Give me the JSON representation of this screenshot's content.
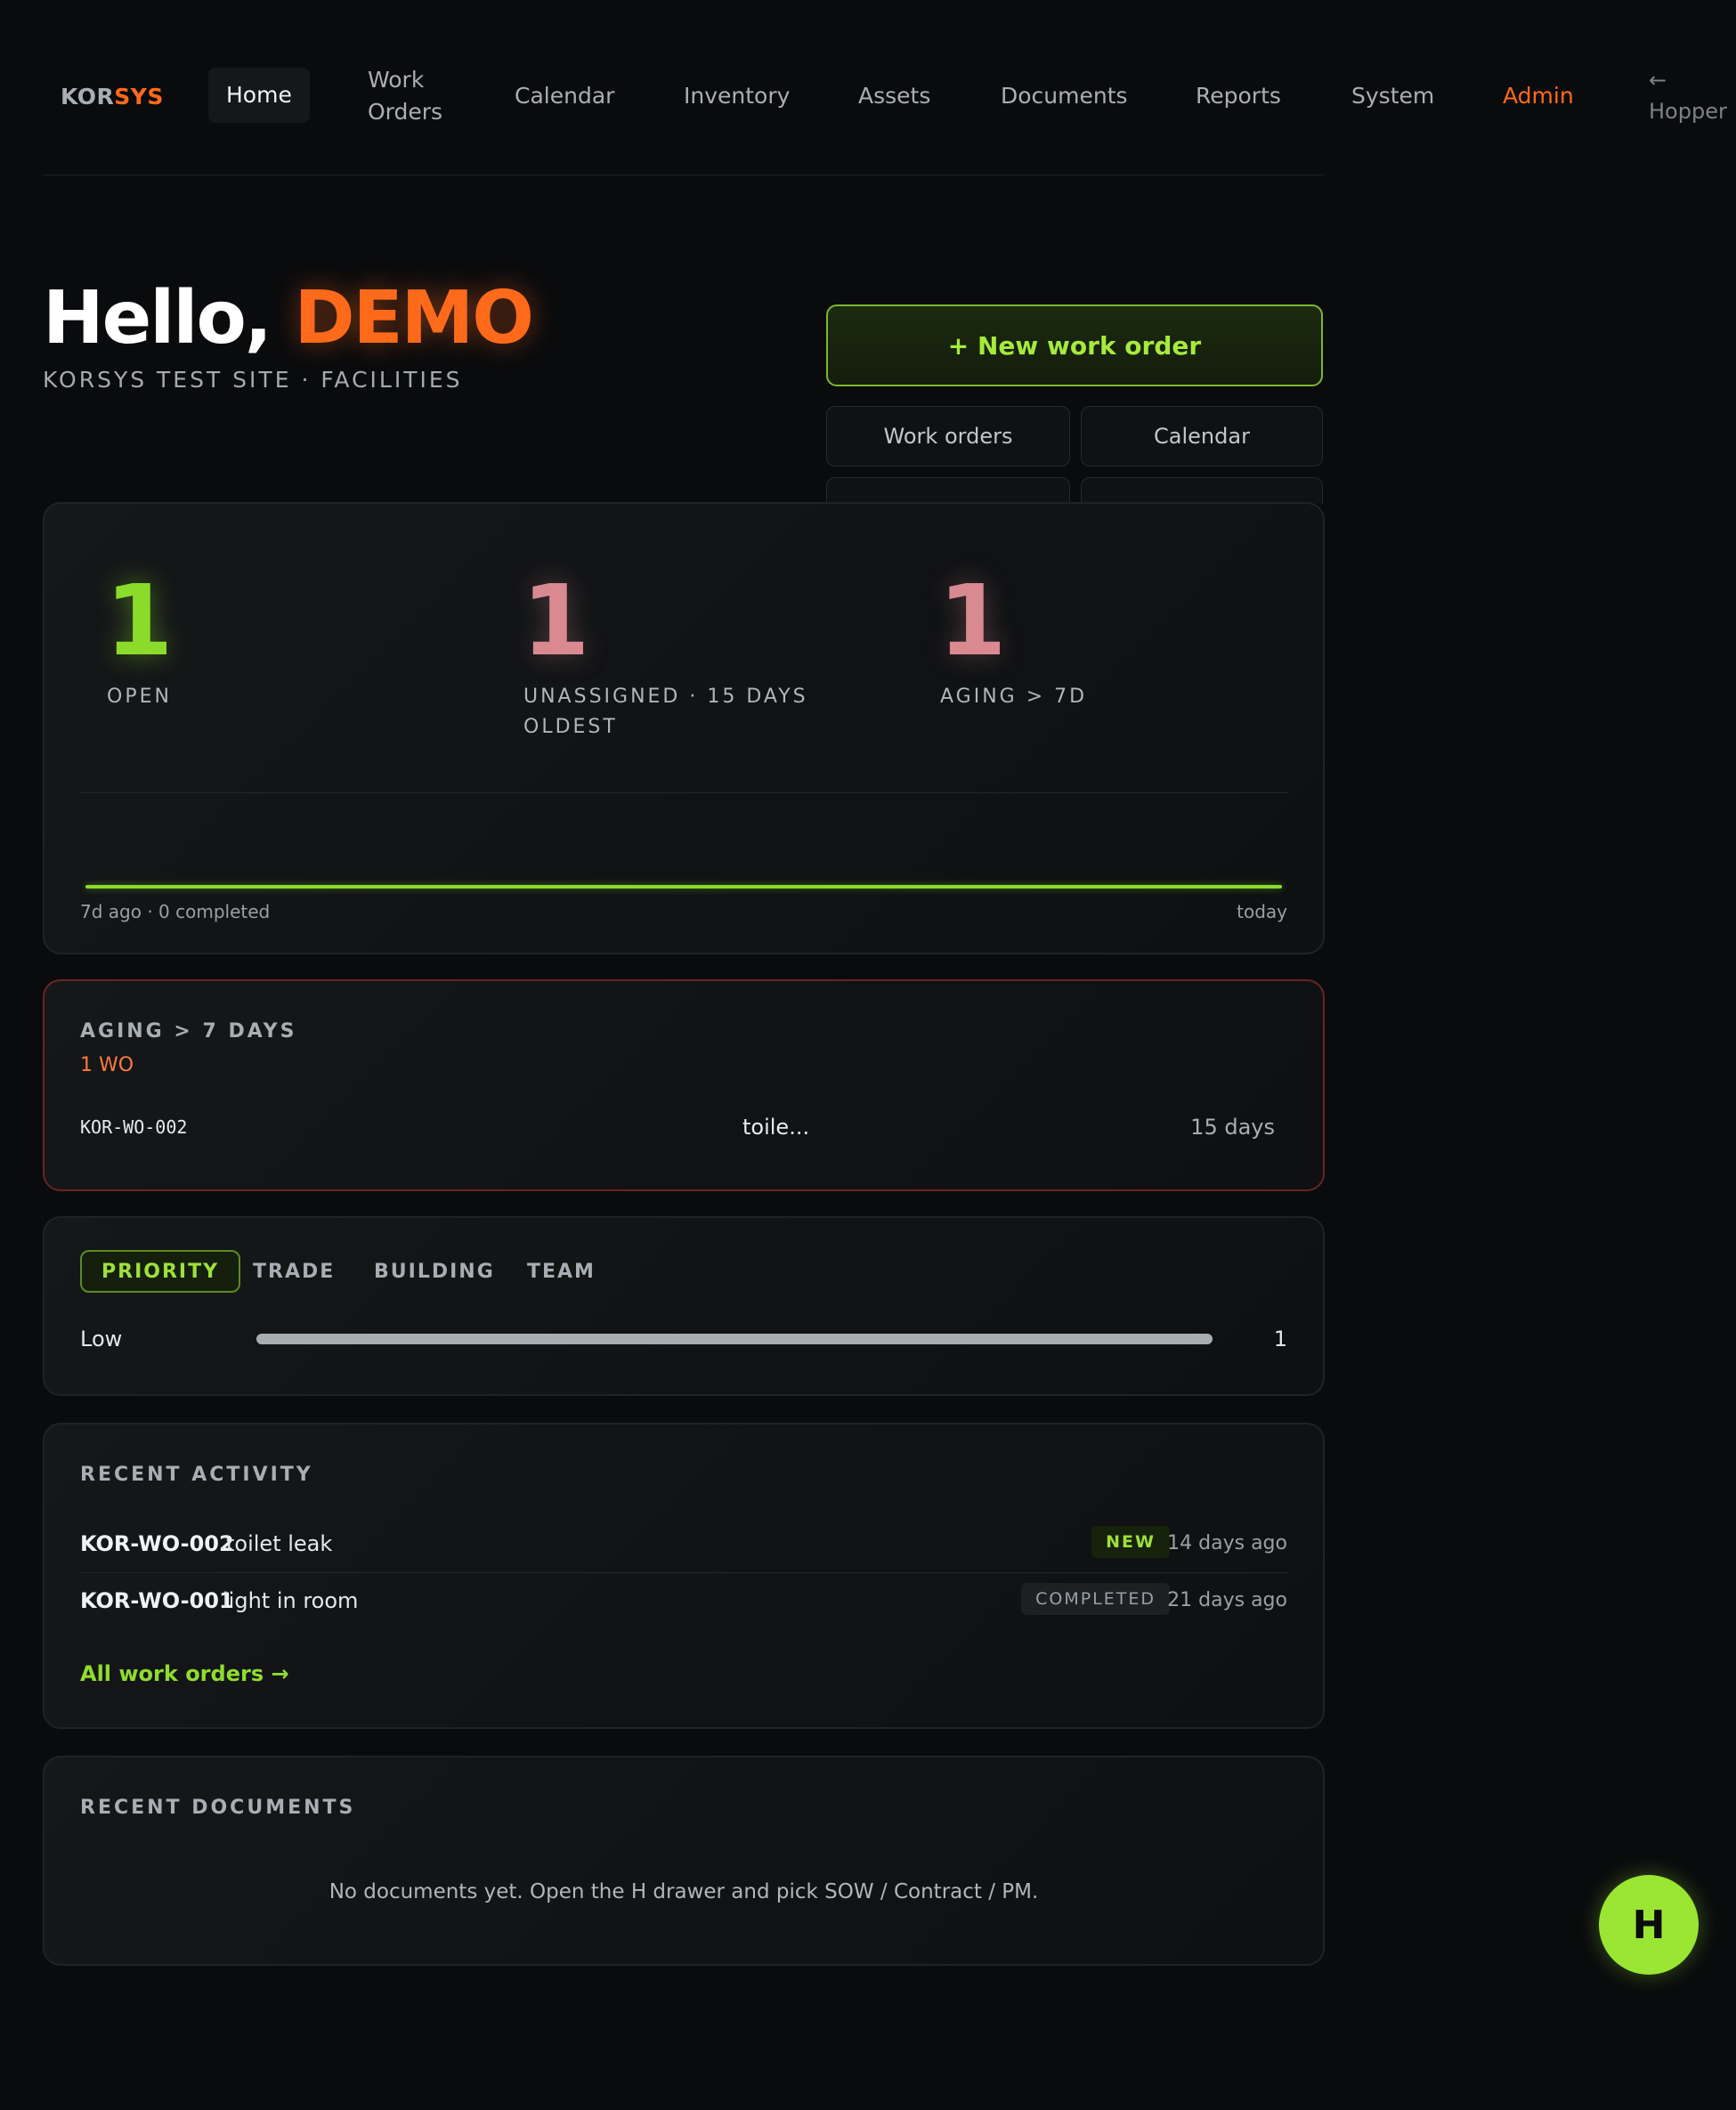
{
  "nav": {
    "logo_a": "KOR",
    "logo_b": "SYS",
    "items": [
      {
        "label": "Home"
      },
      {
        "label": "Work Orders"
      },
      {
        "label": "Calendar"
      },
      {
        "label": "Inventory"
      },
      {
        "label": "Assets"
      },
      {
        "label": "Documents"
      },
      {
        "label": "Reports"
      },
      {
        "label": "System"
      },
      {
        "label": "Admin"
      }
    ],
    "user_arrow": "←",
    "user_name": "Hopper"
  },
  "greeting": {
    "hello": "Hello,",
    "name": "DEMO",
    "site": "KORSYS TEST SITE · FACILITIES"
  },
  "actions": {
    "new_wo": "+ New work order",
    "work_orders": "Work orders",
    "calendar": "Calendar"
  },
  "stats": {
    "open_value": "1",
    "open_label": "OPEN",
    "unassigned_value": "1",
    "unassigned_label_1": "UNASSIGNED · 15 DAYS",
    "unassigned_label_2": "OLDEST",
    "aging_value": "1",
    "aging_label": "AGING > 7D",
    "trend_start": "7d ago · 0 completed",
    "trend_end": "today"
  },
  "aging": {
    "title": "AGING > 7 DAYS",
    "count": "1 WO",
    "row": {
      "id": "KOR-WO-002",
      "title": "toile...",
      "age": "15 days"
    }
  },
  "breakdown": {
    "tabs": [
      "PRIORITY",
      "TRADE",
      "BUILDING",
      "TEAM"
    ],
    "rows": [
      {
        "label": "Low",
        "count": "1",
        "fraction": 1.0
      }
    ]
  },
  "recent_activity": {
    "title": "RECENT ACTIVITY",
    "items": [
      {
        "id": "KOR-WO-002",
        "title": "toilet leak",
        "status": "NEW",
        "time": "14 days ago"
      },
      {
        "id": "KOR-WO-001",
        "title": "light in room",
        "status": "COMPLETED",
        "time": "21 days ago"
      }
    ],
    "link": "All work orders →"
  },
  "recent_documents": {
    "title": "RECENT DOCUMENTS",
    "empty": "No documents yet. Open the H drawer and pick SOW / Contract / PM."
  },
  "fab": {
    "label": "H"
  },
  "colors": {
    "accent": "#8bdc2a",
    "brand": "#ff6a1a",
    "alert": "#d88a90"
  }
}
